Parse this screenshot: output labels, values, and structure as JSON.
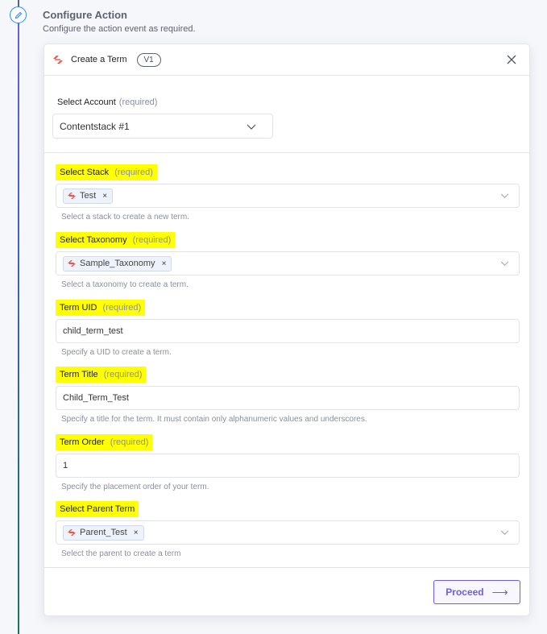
{
  "step": {
    "title": "Configure Action",
    "description": "Configure the action event as required."
  },
  "card": {
    "title": "Create a Term",
    "version": "V1"
  },
  "account": {
    "label": "Select Account",
    "required": "(required)",
    "value": "Contentstack #1"
  },
  "fields": {
    "stack": {
      "label": "Select Stack",
      "required": "(required)",
      "chip": "Test",
      "help": "Select a stack to create a new term."
    },
    "taxonomy": {
      "label": "Select Taxonomy",
      "required": "(required)",
      "chip": "Sample_Taxonomy",
      "help": "Select a taxonomy to create a term."
    },
    "term_uid": {
      "label": "Term UID",
      "required": "(required)",
      "value": "child_term_test",
      "help": "Specify a UID to create a term."
    },
    "term_title": {
      "label": "Term Title",
      "required": "(required)",
      "value": "Child_Term_Test",
      "help": "Specify a title for the term. It must contain only alphanumeric values and underscores."
    },
    "term_order": {
      "label": "Term Order",
      "required": "(required)",
      "value": "1",
      "help": "Specify the placement order of your term."
    },
    "parent_term": {
      "label": "Select Parent Term",
      "chip": "Parent_Test",
      "help": "Select the parent to create a term"
    }
  },
  "footer": {
    "proceed_label": "Proceed",
    "proceed_arrow": "⟶"
  },
  "colors": {
    "accent": "#6c5ce7",
    "highlight": "#ffff00",
    "brand": "#e8574a"
  }
}
